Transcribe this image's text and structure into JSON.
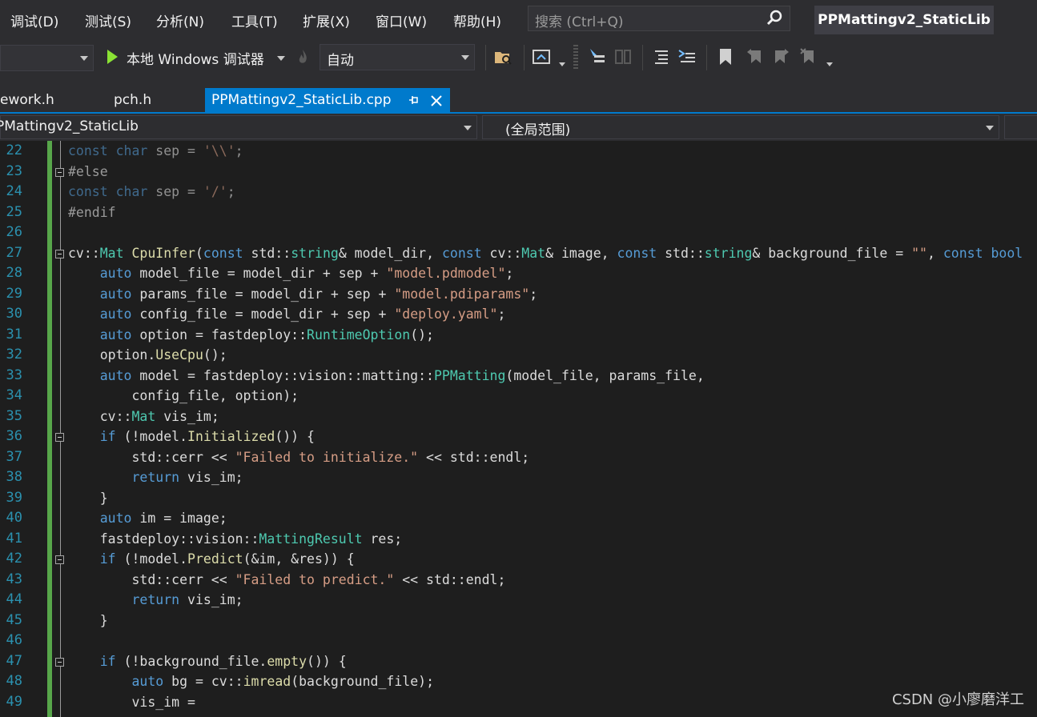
{
  "menu": {
    "items": [
      "调试(D)",
      "测试(S)",
      "分析(N)",
      "工具(T)",
      "扩展(X)",
      "窗口(W)",
      "帮助(H)"
    ]
  },
  "search": {
    "placeholder": "搜索 (Ctrl+Q)"
  },
  "solution_title": "PPMattingv2_StaticLib",
  "toolbar": {
    "run_label": "本地 Windows 调试器",
    "config_value": "自动"
  },
  "tabs": [
    {
      "label": "ework.h",
      "active": false
    },
    {
      "label": "pch.h",
      "active": false
    },
    {
      "label": "PPMattingv2_StaticLib.cpp",
      "active": true
    }
  ],
  "navbar": {
    "project": "PMattingv2_StaticLib",
    "scope": "(全局范围)"
  },
  "colors": {
    "accent": "#007acc",
    "keyword": "#569cd6",
    "type": "#4ec9b0",
    "string": "#d69d85",
    "function": "#dcdcaa",
    "variable": "#9cdcfe",
    "line_number": "#2b91af",
    "change_bar": "#57a64a"
  },
  "editor": {
    "lines": [
      {
        "n": "22",
        "text": "const char sep = '\\\\';"
      },
      {
        "n": "23",
        "text": "#else"
      },
      {
        "n": "24",
        "text": "const char sep = '/';"
      },
      {
        "n": "25",
        "text": "#endif"
      },
      {
        "n": "26",
        "text": ""
      },
      {
        "n": "27",
        "text": "cv::Mat CpuInfer(const std::string& model_dir, const cv::Mat& image, const std::string& background_file = \"\", const bool"
      },
      {
        "n": "28",
        "text": "    auto model_file = model_dir + sep + \"model.pdmodel\";"
      },
      {
        "n": "29",
        "text": "    auto params_file = model_dir + sep + \"model.pdiparams\";"
      },
      {
        "n": "30",
        "text": "    auto config_file = model_dir + sep + \"deploy.yaml\";"
      },
      {
        "n": "31",
        "text": "    auto option = fastdeploy::RuntimeOption();"
      },
      {
        "n": "32",
        "text": "    option.UseCpu();"
      },
      {
        "n": "33",
        "text": "    auto model = fastdeploy::vision::matting::PPMatting(model_file, params_file,"
      },
      {
        "n": "34",
        "text": "        config_file, option);"
      },
      {
        "n": "35",
        "text": "    cv::Mat vis_im;"
      },
      {
        "n": "36",
        "text": "    if (!model.Initialized()) {"
      },
      {
        "n": "37",
        "text": "        std::cerr << \"Failed to initialize.\" << std::endl;"
      },
      {
        "n": "38",
        "text": "        return vis_im;"
      },
      {
        "n": "39",
        "text": "    }"
      },
      {
        "n": "40",
        "text": "    auto im = image;"
      },
      {
        "n": "41",
        "text": "    fastdeploy::vision::MattingResult res;"
      },
      {
        "n": "42",
        "text": "    if (!model.Predict(&im, &res)) {"
      },
      {
        "n": "43",
        "text": "        std::cerr << \"Failed to predict.\" << std::endl;"
      },
      {
        "n": "44",
        "text": "        return vis_im;"
      },
      {
        "n": "45",
        "text": "    }"
      },
      {
        "n": "46",
        "text": ""
      },
      {
        "n": "47",
        "text": "    if (!background_file.empty()) {"
      },
      {
        "n": "48",
        "text": "        auto bg = cv::imread(background_file);"
      },
      {
        "n": "49",
        "text": "        vis_im ="
      }
    ]
  },
  "watermark": "CSDN @小廖磨洋工"
}
